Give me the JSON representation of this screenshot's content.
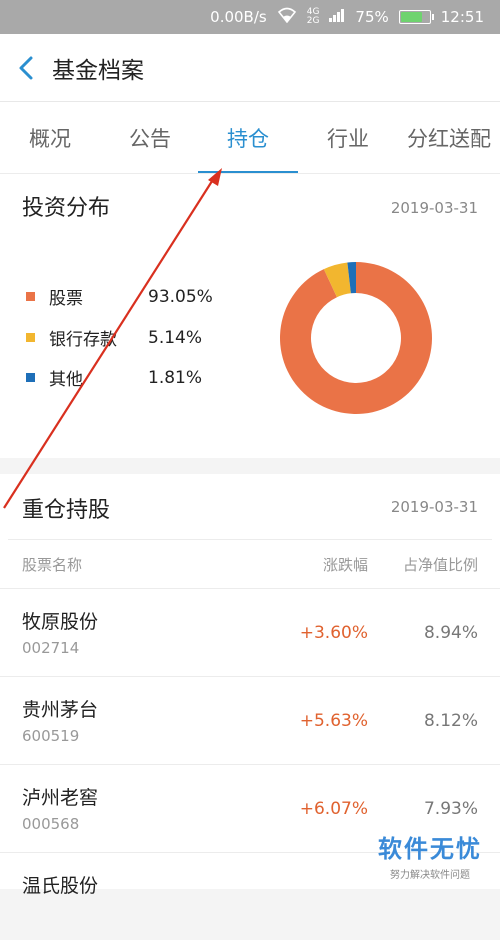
{
  "status": {
    "speed": "0.00B/s",
    "network": "4G 2G",
    "battery": "75%",
    "time": "12:51"
  },
  "header": {
    "title": "基金档案"
  },
  "tabs": [
    "概况",
    "公告",
    "持仓",
    "行业",
    "分红送配"
  ],
  "distribution": {
    "title": "投资分布",
    "date": "2019-03-31",
    "items": [
      {
        "label": "股票",
        "pct": "93.05%",
        "color": "#ea7347"
      },
      {
        "label": "银行存款",
        "pct": "5.14%",
        "color": "#f2b62f"
      },
      {
        "label": "其他",
        "pct": "1.81%",
        "color": "#1e6fb8"
      }
    ],
    "chart_data": {
      "type": "pie",
      "categories": [
        "股票",
        "银行存款",
        "其他"
      ],
      "values": [
        93.05,
        5.14,
        1.81
      ]
    }
  },
  "holdings": {
    "title": "重仓持股",
    "date": "2019-03-31",
    "columns": {
      "name": "股票名称",
      "change": "涨跌幅",
      "ratio": "占净值比例"
    },
    "rows": [
      {
        "name": "牧原股份",
        "code": "002714",
        "change": "+3.60%",
        "ratio": "8.94%"
      },
      {
        "name": "贵州茅台",
        "code": "600519",
        "change": "+5.63%",
        "ratio": "8.12%"
      },
      {
        "name": "泸州老窖",
        "code": "000568",
        "change": "+6.07%",
        "ratio": "7.93%"
      },
      {
        "name": "温氏股份",
        "code": "",
        "change": "",
        "ratio": ""
      }
    ]
  },
  "watermark": {
    "brand": "软件无忧",
    "slogan": "努力解决软件问题"
  }
}
